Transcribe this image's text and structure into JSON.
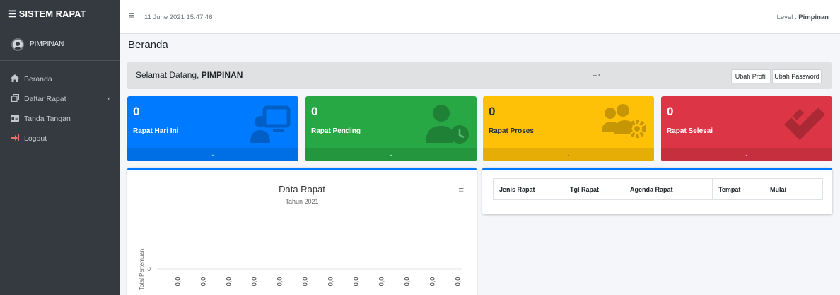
{
  "sidebar": {
    "brand": "SISTEM RAPAT",
    "user": "PIMPINAN",
    "items": [
      {
        "label": "Beranda",
        "icon": "home-icon"
      },
      {
        "label": "Daftar Rapat",
        "icon": "copy-icon"
      },
      {
        "label": "Tanda Tangan",
        "icon": "id-card-icon"
      },
      {
        "label": "Logout",
        "icon": "sign-out-icon"
      }
    ]
  },
  "topbar": {
    "datetime": "11 June 2021 15:47:46",
    "level_label": "Level : ",
    "level_value": "Pimpinan"
  },
  "page": {
    "title": "Beranda"
  },
  "welcome": {
    "text": "Selamat Datang, ",
    "name": "PIMPINAN",
    "arrow": "-->",
    "btn_profil": "Ubah Profil",
    "btn_password": "Ubah Password"
  },
  "stats": [
    {
      "value": "0",
      "label": "Rapat Hari Ini",
      "footer": "-",
      "color": "#007bff"
    },
    {
      "value": "0",
      "label": "Rapat Pending",
      "footer": "-",
      "color": "#28a745"
    },
    {
      "value": "0",
      "label": "Rapat Proses",
      "footer": "-",
      "color": "#ffc107"
    },
    {
      "value": "0",
      "label": "Rapat Selesai",
      "footer": "-",
      "color": "#dc3545"
    }
  ],
  "table": {
    "headers": [
      "Jenis Rapat",
      "Tgl Rapat",
      "Agenda Rapat",
      "Tempat",
      "Mulai"
    ]
  },
  "chart_data": {
    "type": "bar",
    "title": "Data Rapat",
    "subtitle": "Tahun 2021",
    "ylabel": "Total Pertemuan",
    "xlabel": "",
    "y_ticks": [
      "0"
    ],
    "categories": [
      "0,0",
      "0,0",
      "0,0",
      "0,0",
      "0,0",
      "0,0",
      "0,0",
      "0,0",
      "0,0",
      "0,0",
      "0,0",
      "0,0"
    ],
    "values": [
      0,
      0,
      0,
      0,
      0,
      0,
      0,
      0,
      0,
      0,
      0,
      0
    ]
  }
}
